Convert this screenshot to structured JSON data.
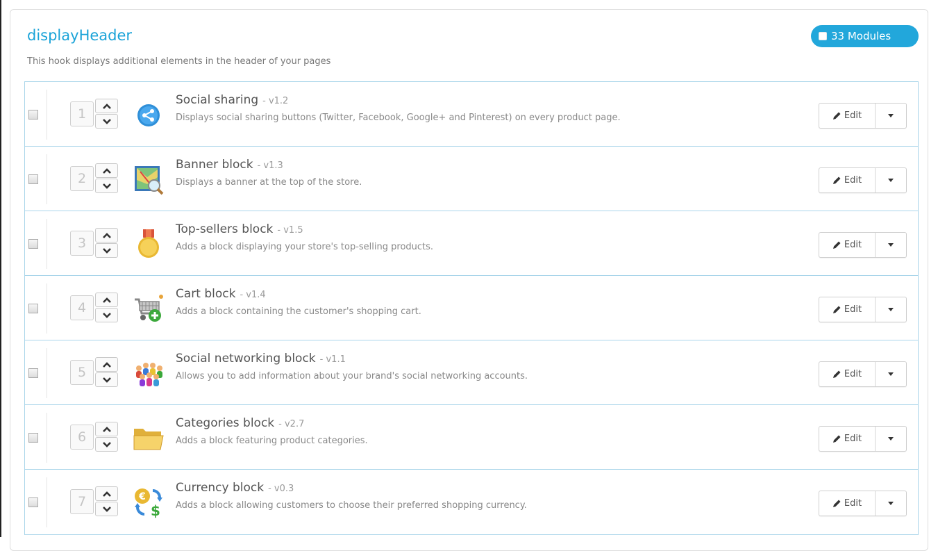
{
  "hook": {
    "title": "displayHeader",
    "description": "This hook displays additional elements in the header of your pages",
    "modules_count": "33 Modules"
  },
  "edit_label": "Edit",
  "modules": [
    {
      "position": "1",
      "name": "Social sharing",
      "version": "- v1.2",
      "description": "Displays social sharing buttons (Twitter, Facebook, Google+ and Pinterest) on every product page.",
      "icon": "social-sharing-icon"
    },
    {
      "position": "2",
      "name": "Banner block",
      "version": "- v1.3",
      "description": "Displays a banner at the top of the store.",
      "icon": "banner-icon"
    },
    {
      "position": "3",
      "name": "Top-sellers block",
      "version": "- v1.5",
      "description": "Adds a block displaying your store's top-selling products.",
      "icon": "medal-icon"
    },
    {
      "position": "4",
      "name": "Cart block",
      "version": "- v1.4",
      "description": "Adds a block containing the customer's shopping cart.",
      "icon": "cart-add-icon"
    },
    {
      "position": "5",
      "name": "Social networking block",
      "version": "- v1.1",
      "description": "Allows you to add information about your brand's social networking accounts.",
      "icon": "people-group-icon"
    },
    {
      "position": "6",
      "name": "Categories block",
      "version": "- v2.7",
      "description": "Adds a block featuring product categories.",
      "icon": "folder-icon"
    },
    {
      "position": "7",
      "name": "Currency block",
      "version": "- v0.3",
      "description": "Adds a block allowing customers to choose their preferred shopping currency.",
      "icon": "currency-exchange-icon"
    }
  ]
}
